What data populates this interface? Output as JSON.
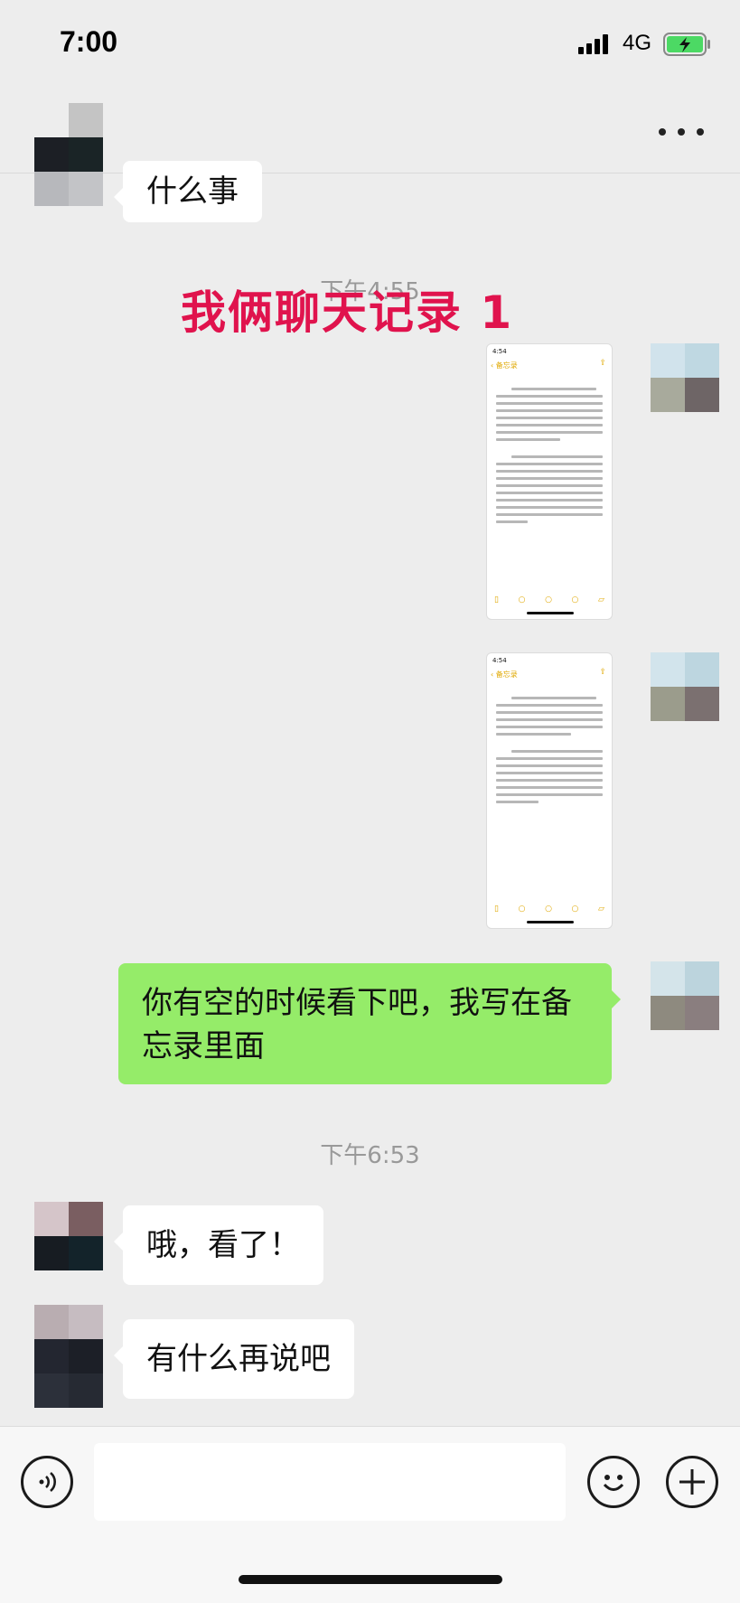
{
  "status_bar": {
    "time": "7:00",
    "network": "4G"
  },
  "nav": {
    "title": ""
  },
  "overlay": {
    "title": "我俩聊天记录 1"
  },
  "messages": {
    "m1": {
      "side": "left",
      "text": "什么事"
    },
    "ts1": "下午4:55",
    "m2": {
      "side": "right",
      "type": "image",
      "description": "memo screenshot"
    },
    "m3": {
      "side": "right",
      "type": "image",
      "description": "memo screenshot"
    },
    "m4": {
      "side": "right",
      "text": "你有空的时候看下吧，我写在备忘录里面"
    },
    "ts2": "下午6:53",
    "m5": {
      "side": "left",
      "text": "哦，看了！"
    },
    "m6": {
      "side": "left",
      "text": "有什么再说吧"
    }
  },
  "memo1": {
    "time": "4:54",
    "back": "备忘录"
  },
  "memo2": {
    "time": "4:54",
    "back": "备忘录"
  },
  "input": {
    "placeholder": ""
  },
  "colors": {
    "bubble_right": "#95ec69",
    "bubble_left": "#ffffff",
    "background": "#ededed",
    "overlay_title": "#e0134d"
  },
  "icons": [
    "signal-icon",
    "battery-charging-icon",
    "more-icon",
    "voice-icon",
    "emoji-icon",
    "plus-icon"
  ]
}
